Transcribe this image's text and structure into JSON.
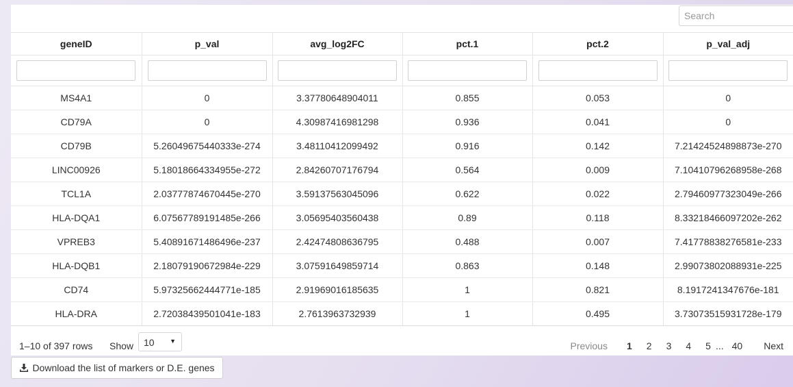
{
  "search": {
    "placeholder": "Search"
  },
  "table": {
    "columns": [
      "geneID",
      "p_val",
      "avg_log2FC",
      "pct.1",
      "pct.2",
      "p_val_adj"
    ],
    "rows": [
      [
        "MS4A1",
        "0",
        "3.37780648904011",
        "0.855",
        "0.053",
        "0"
      ],
      [
        "CD79A",
        "0",
        "4.30987416981298",
        "0.936",
        "0.041",
        "0"
      ],
      [
        "CD79B",
        "5.26049675440333e-274",
        "3.48110412099492",
        "0.916",
        "0.142",
        "7.21424524898873e-270"
      ],
      [
        "LINC00926",
        "5.18018664334955e-272",
        "2.84260707176794",
        "0.564",
        "0.009",
        "7.10410796268958e-268"
      ],
      [
        "TCL1A",
        "2.03777874670445e-270",
        "3.59137563045096",
        "0.622",
        "0.022",
        "2.79460977323049e-266"
      ],
      [
        "HLA-DQA1",
        "6.07567789191485e-266",
        "3.05695403560438",
        "0.89",
        "0.118",
        "8.33218466097202e-262"
      ],
      [
        "VPREB3",
        "5.40891671486496e-237",
        "2.42474808636795",
        "0.488",
        "0.007",
        "7.41778838276581e-233"
      ],
      [
        "HLA-DQB1",
        "2.18079190672984e-229",
        "3.07591649859714",
        "0.863",
        "0.148",
        "2.99073802088931e-225"
      ],
      [
        "CD74",
        "5.97325662444771e-185",
        "2.91969016185635",
        "1",
        "0.821",
        "8.1917241347676e-181"
      ],
      [
        "HLA-DRA",
        "2.72038439501041e-183",
        "2.7613963732939",
        "1",
        "0.495",
        "3.73073515931728e-179"
      ]
    ]
  },
  "footer": {
    "info": "1–10 of 397 rows",
    "show_label": "Show",
    "page_size": "10",
    "pagination": {
      "previous": "Previous",
      "pages": [
        "1",
        "2",
        "3",
        "4",
        "5"
      ],
      "ellipsis": "...",
      "last": "40",
      "next": "Next",
      "current": "1"
    }
  },
  "download_button": {
    "label": "Download the list of markers or D.E. genes",
    "icon": "download-icon"
  }
}
